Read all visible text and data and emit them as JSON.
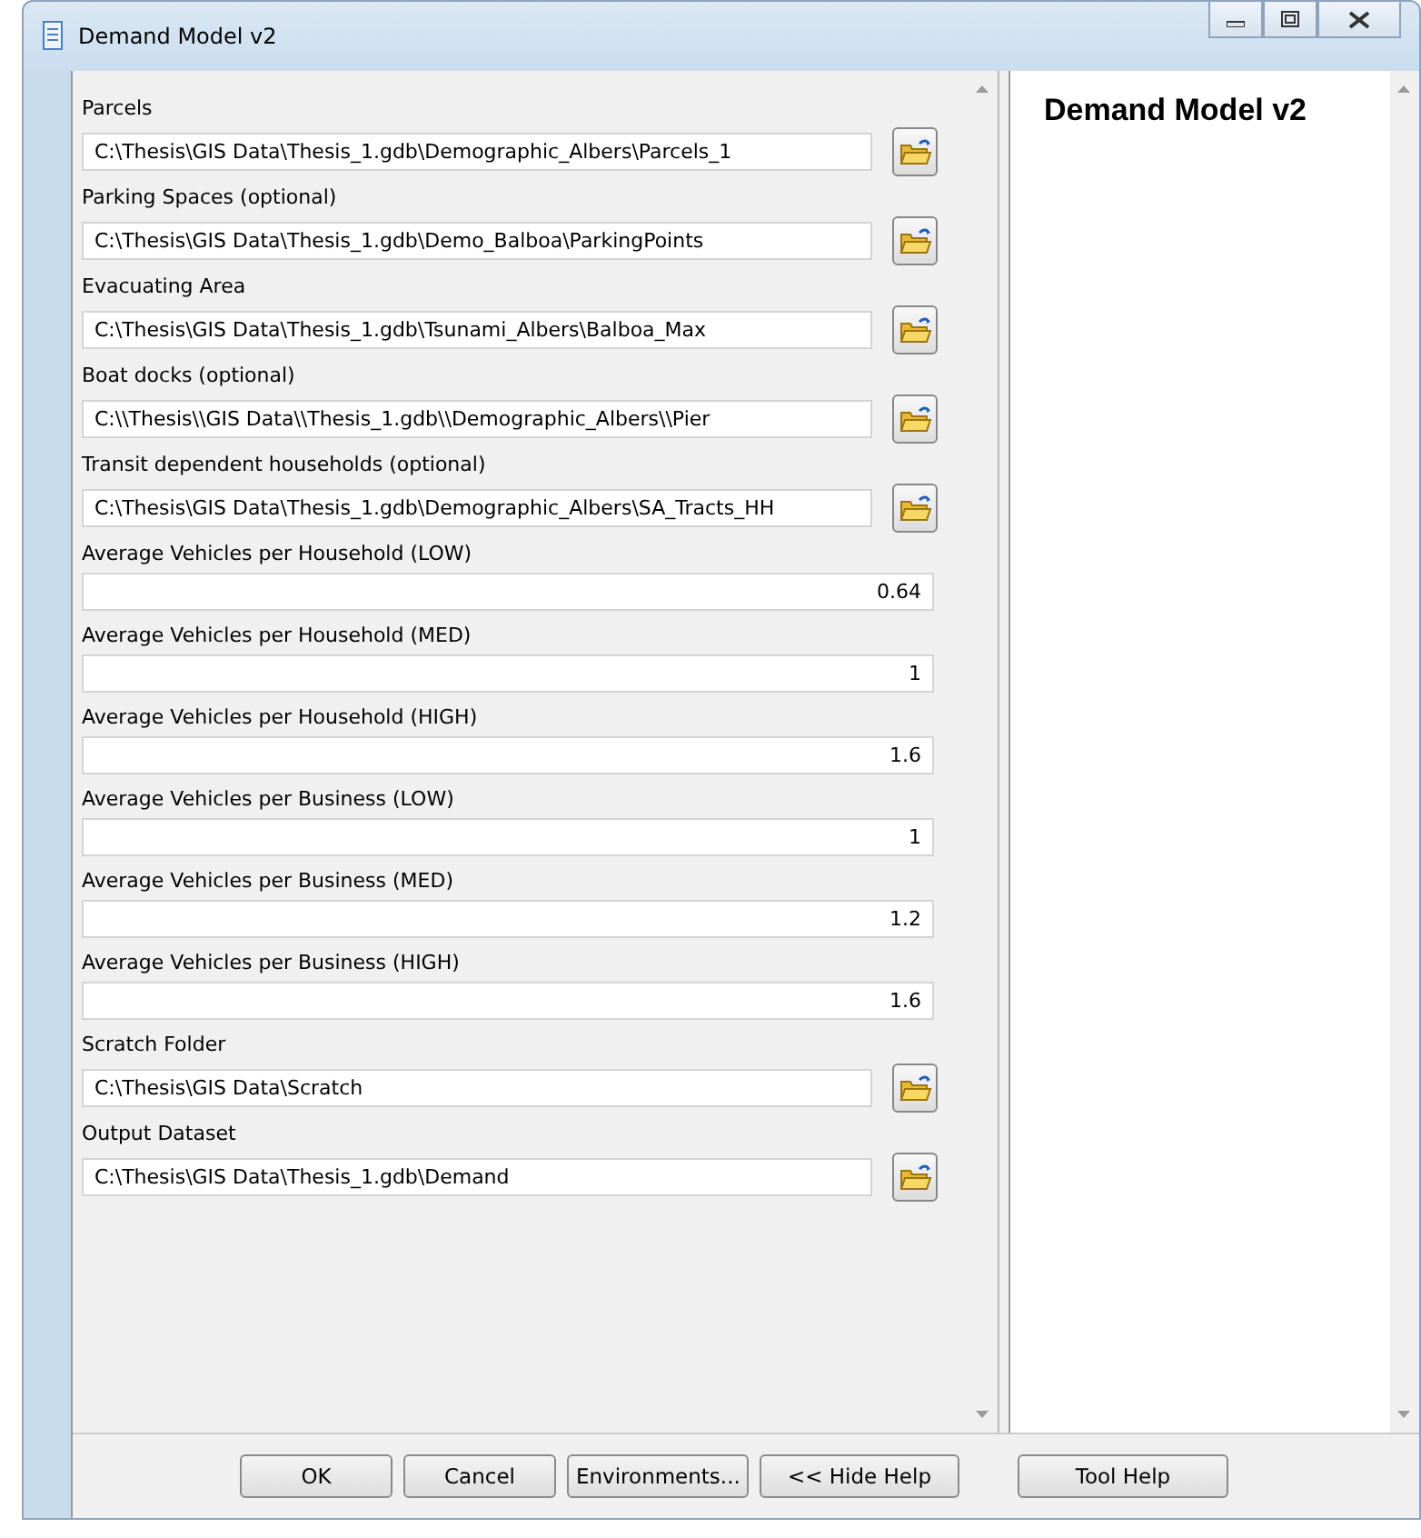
{
  "window": {
    "title": "Demand Model v2"
  },
  "parameters": [
    {
      "label": "Parcels",
      "kind": "path",
      "value": "C:\\Thesis\\GIS Data\\Thesis_1.gdb\\Demographic_Albers\\Parcels_1"
    },
    {
      "label": "Parking Spaces (optional)",
      "kind": "path",
      "value": "C:\\Thesis\\GIS Data\\Thesis_1.gdb\\Demo_Balboa\\ParkingPoints"
    },
    {
      "label": "Evacuating Area",
      "kind": "path",
      "value": "C:\\Thesis\\GIS Data\\Thesis_1.gdb\\Tsunami_Albers\\Balboa_Max"
    },
    {
      "label": "Boat docks (optional)",
      "kind": "path",
      "value": "C:\\\\Thesis\\\\GIS Data\\\\Thesis_1.gdb\\\\Demographic_Albers\\\\Pier"
    },
    {
      "label": "Transit dependent households (optional)",
      "kind": "path",
      "value": "C:\\Thesis\\GIS Data\\Thesis_1.gdb\\Demographic_Albers\\SA_Tracts_HH"
    },
    {
      "label": "Average Vehicles per Household (LOW)",
      "kind": "number",
      "value": "0.64"
    },
    {
      "label": "Average Vehicles per Household (MED)",
      "kind": "number",
      "value": "1"
    },
    {
      "label": "Average Vehicles per Household (HIGH)",
      "kind": "number",
      "value": "1.6"
    },
    {
      "label": "Average Vehicles per Business (LOW)",
      "kind": "number",
      "value": "1"
    },
    {
      "label": "Average Vehicles per Business (MED)",
      "kind": "number",
      "value": "1.2"
    },
    {
      "label": "Average Vehicles per Business (HIGH)",
      "kind": "number",
      "value": "1.6"
    },
    {
      "label": "Scratch Folder",
      "kind": "path",
      "value": "C:\\Thesis\\GIS Data\\Scratch"
    },
    {
      "label": "Output Dataset",
      "kind": "path",
      "value": "C:\\Thesis\\GIS Data\\Thesis_1.gdb\\Demand"
    }
  ],
  "help": {
    "title": "Demand Model v2"
  },
  "buttons": [
    "OK",
    "Cancel",
    "Environments...",
    "<< Hide Help",
    "Tool Help"
  ]
}
